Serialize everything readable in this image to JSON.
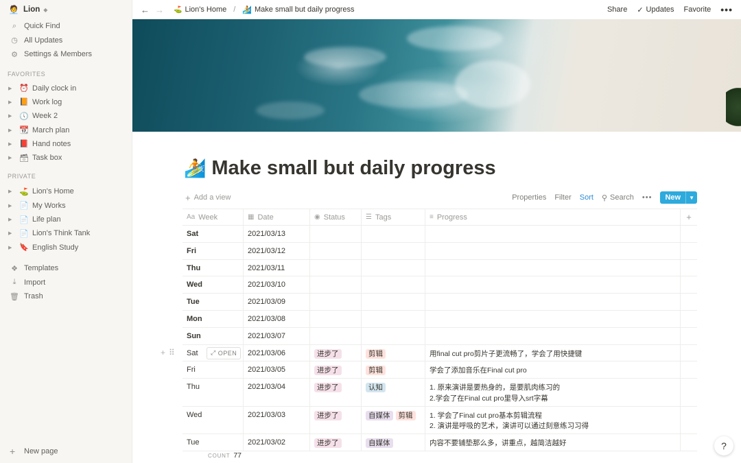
{
  "sidebar": {
    "workspace": "Lion",
    "nav": [
      {
        "label": "Quick Find",
        "icon": "search-icon"
      },
      {
        "label": "All Updates",
        "icon": "clock-icon"
      },
      {
        "label": "Settings & Members",
        "icon": "gear-icon"
      }
    ],
    "favorites_title": "FAVORITES",
    "favorites": [
      {
        "label": "Daily clock in",
        "emoji": "⏰"
      },
      {
        "label": "Work log",
        "emoji": "📙"
      },
      {
        "label": "Week 2",
        "emoji": "🕔"
      },
      {
        "label": "March plan",
        "emoji": "📆"
      },
      {
        "label": "Hand notes",
        "emoji": "📕"
      },
      {
        "label": "Task box",
        "emoji": "🗃"
      }
    ],
    "private_title": "PRIVATE",
    "private": [
      {
        "label": "Lion's Home",
        "emoji": "⛳"
      },
      {
        "label": "My Works",
        "emoji": "📄"
      },
      {
        "label": "Life plan",
        "emoji": "📄"
      },
      {
        "label": "Lion's Think Tank",
        "emoji": "📄"
      },
      {
        "label": "English Study",
        "emoji": "🔖"
      }
    ],
    "tools": [
      {
        "label": "Templates",
        "icon": "templates-icon"
      },
      {
        "label": "Import",
        "icon": "import-icon"
      },
      {
        "label": "Trash",
        "icon": "trash-icon"
      }
    ],
    "new_page": "New page"
  },
  "topbar": {
    "crumb_home": "Lion's Home",
    "crumb_page": "Make small but daily progress",
    "share": "Share",
    "updates": "Updates",
    "favorite": "Favorite"
  },
  "page": {
    "emoji": "🏄",
    "title": "Make small but daily progress"
  },
  "viewbar": {
    "add_view": "Add a view",
    "properties": "Properties",
    "filter": "Filter",
    "sort": "Sort",
    "search": "Search",
    "new": "New"
  },
  "table": {
    "columns": [
      "Week",
      "Date",
      "Status",
      "Tags",
      "Progress"
    ],
    "rows": [
      {
        "week": "Sat",
        "date": "2021/03/13",
        "status": [],
        "tags": [],
        "progress": ""
      },
      {
        "week": "Fri",
        "date": "2021/03/12",
        "status": [],
        "tags": [],
        "progress": ""
      },
      {
        "week": "Thu",
        "date": "2021/03/11",
        "status": [],
        "tags": [],
        "progress": ""
      },
      {
        "week": "Wed",
        "date": "2021/03/10",
        "status": [],
        "tags": [],
        "progress": ""
      },
      {
        "week": "Tue",
        "date": "2021/03/09",
        "status": [],
        "tags": [],
        "progress": ""
      },
      {
        "week": "Mon",
        "date": "2021/03/08",
        "status": [],
        "tags": [],
        "progress": ""
      },
      {
        "week": "Sun",
        "date": "2021/03/07",
        "status": [],
        "tags": [],
        "progress": ""
      },
      {
        "week": "Sat",
        "date": "2021/03/06",
        "status": [
          "进步了"
        ],
        "tags": [
          "剪辑"
        ],
        "progress": "用final cut pro剪片子更流畅了，学会了用快捷键",
        "open": "OPEN"
      },
      {
        "week": "Fri",
        "date": "2021/03/05",
        "status": [
          "进步了"
        ],
        "tags": [
          "剪辑"
        ],
        "progress": "学会了添加音乐在Final cut pro"
      },
      {
        "week": "Thu",
        "date": "2021/03/04",
        "status": [
          "进步了"
        ],
        "tags": [
          "认知"
        ],
        "progress": "1. 原来演讲是要热身的，是要肌肉练习的\n2.学会了在Final cut pro里导入srt字幕"
      },
      {
        "week": "Wed",
        "date": "2021/03/03",
        "status": [
          "进步了"
        ],
        "tags": [
          "自媒体",
          "剪辑"
        ],
        "progress": "1. 学会了Final cut pro基本剪辑流程\n2. 演讲是呼吸的艺术，演讲可以通过刻意练习习得"
      },
      {
        "week": "Tue",
        "date": "2021/03/02",
        "status": [
          "进步了"
        ],
        "tags": [
          "自媒体"
        ],
        "progress": "内容不要铺垫那么多，讲重点，越简洁越好"
      }
    ],
    "tag_colors": {
      "进步了": "t-pink",
      "剪辑": "t-red",
      "认知": "t-blue",
      "自媒体": "t-purple"
    },
    "count_label": "COUNT",
    "count": "77"
  },
  "help": "?",
  "colors": {
    "accent": "#2eaadc",
    "sort": "#2e8bd6"
  }
}
